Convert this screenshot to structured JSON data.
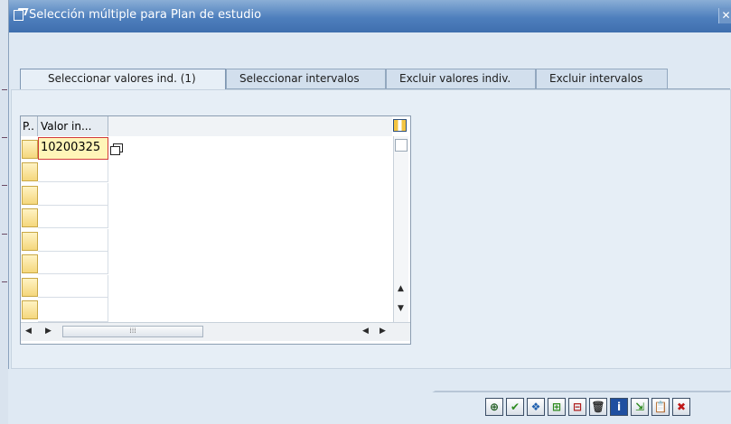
{
  "dialog": {
    "title": "Selección múltiple para Plan de estudio",
    "close_glyph": "✕"
  },
  "tabs": [
    {
      "label": "Seleccionar valores ind. (1)",
      "active": true
    },
    {
      "label": "Seleccionar intervalos",
      "active": false
    },
    {
      "label": "Excluir valores indiv.",
      "active": false
    },
    {
      "label": "Excluir intervalos",
      "active": false
    }
  ],
  "table": {
    "col_pos_header": "P..",
    "col_value_header": "Valor in...",
    "rows": [
      "10200325",
      "",
      "",
      "",
      "",
      "",
      "",
      ""
    ]
  },
  "toolbar": {
    "buttons": [
      {
        "icon": "clock-icon",
        "glyph": "⊕"
      },
      {
        "icon": "checkmark-icon",
        "glyph": "✔"
      },
      {
        "icon": "multiple-selection-icon",
        "glyph": "❖"
      },
      {
        "icon": "insert-line-icon",
        "glyph": "⊞"
      },
      {
        "icon": "delete-line-icon",
        "glyph": "⊟"
      },
      {
        "icon": "trash-icon",
        "glyph": "🗑"
      },
      {
        "icon": "info-icon",
        "glyph": "i"
      },
      {
        "icon": "import-icon",
        "glyph": "⇲"
      },
      {
        "icon": "paste-clipboard-icon",
        "glyph": "📋"
      },
      {
        "icon": "cancel-icon",
        "glyph": "✖"
      }
    ]
  }
}
